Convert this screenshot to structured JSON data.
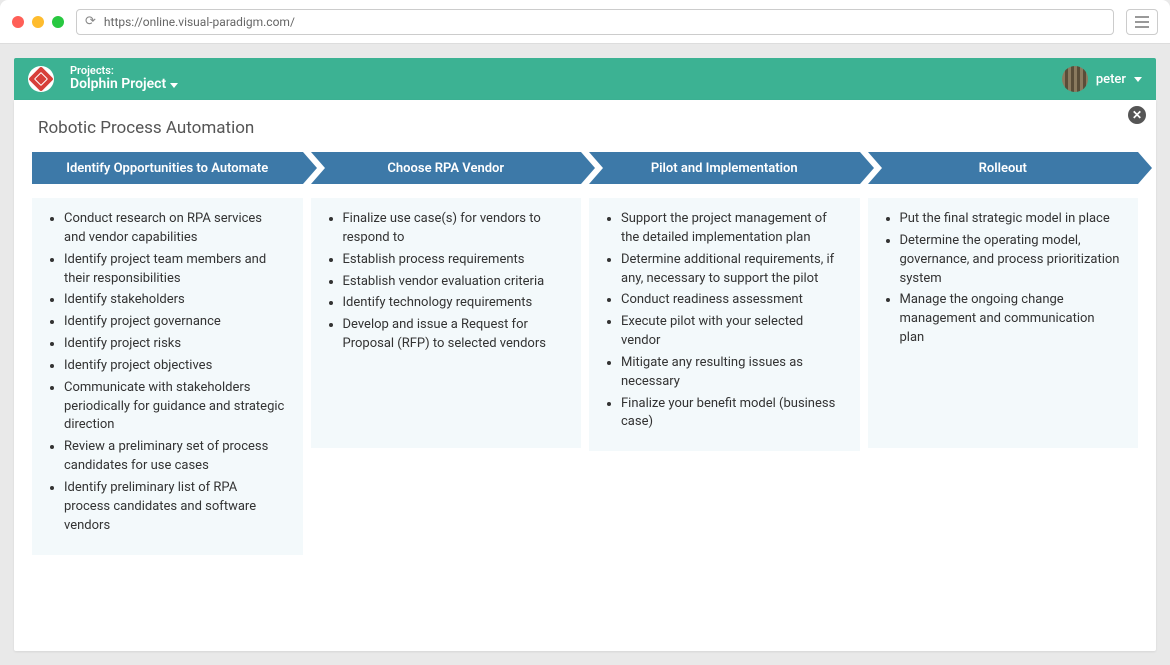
{
  "browser": {
    "url": "https://online.visual-paradigm.com/"
  },
  "header": {
    "projects_label": "Projects:",
    "project_name": "Dolphin Project",
    "user_name": "peter"
  },
  "page": {
    "title": "Robotic Process Automation"
  },
  "columns": [
    {
      "title": "Identify Opportunities to Automate",
      "items": [
        "Conduct research on RPA services and vendor capabilities",
        "Identify project team members and their responsibilities",
        "Identify stakeholders",
        "Identify project governance",
        "Identify project risks",
        "Identify project objectives",
        "Communicate with stakeholders periodically for guidance and strategic direction",
        "Review a preliminary set of process candidates for use cases",
        "Identify preliminary list of RPA process candidates and software vendors"
      ]
    },
    {
      "title": "Choose RPA Vendor",
      "items": [
        "Finalize use case(s) for vendors to respond to",
        "Establish process requirements",
        "Establish vendor evaluation criteria",
        "Identify technology requirements",
        "Develop and issue a Request for Proposal (RFP) to selected vendors"
      ]
    },
    {
      "title": "Pilot and Implementation",
      "items": [
        "Support the project management of the detailed implementation plan",
        "Determine additional requirements, if any, necessary to support the pilot",
        "Conduct readiness assessment",
        "Execute pilot with your selected vendor",
        "Mitigate any resulting issues as necessary",
        "Finalize your benefit model (business case)"
      ]
    },
    {
      "title": "Rolleout",
      "items": [
        "Put the final strategic model in place",
        "Determine the operating model, governance, and process prioritization system",
        "Manage the ongoing change management and communication plan"
      ]
    }
  ]
}
